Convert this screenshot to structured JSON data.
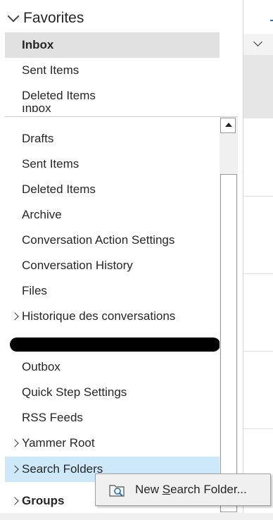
{
  "favorites": {
    "header": "Favorites",
    "items": [
      {
        "label": "Inbox",
        "selected": true
      },
      {
        "label": "Sent Items"
      },
      {
        "label": "Deleted Items"
      }
    ]
  },
  "folders": {
    "partial_top_label": "Inbox",
    "items": [
      {
        "label": "Drafts"
      },
      {
        "label": "Sent Items"
      },
      {
        "label": "Deleted Items"
      },
      {
        "label": "Archive"
      },
      {
        "label": "Conversation Action Settings"
      },
      {
        "label": "Conversation History"
      },
      {
        "label": "Files"
      },
      {
        "label": "Historique des conversations",
        "expandable": true
      },
      {
        "label": "Outbox"
      },
      {
        "label": "Quick Step Settings"
      },
      {
        "label": "RSS Feeds"
      },
      {
        "label": "Yammer Root",
        "expandable": true
      },
      {
        "label": "Search Folders",
        "expandable": true,
        "highlighted": true
      }
    ],
    "groups_label": "Groups"
  },
  "context_menu": {
    "item_prefix": "New ",
    "item_accel": "S",
    "item_suffix": "earch Folder..."
  },
  "colors": {
    "selected_bg": "#e1e1e1",
    "highlight_bg": "#cde8f8",
    "menu_bg": "#f0f0f0"
  }
}
